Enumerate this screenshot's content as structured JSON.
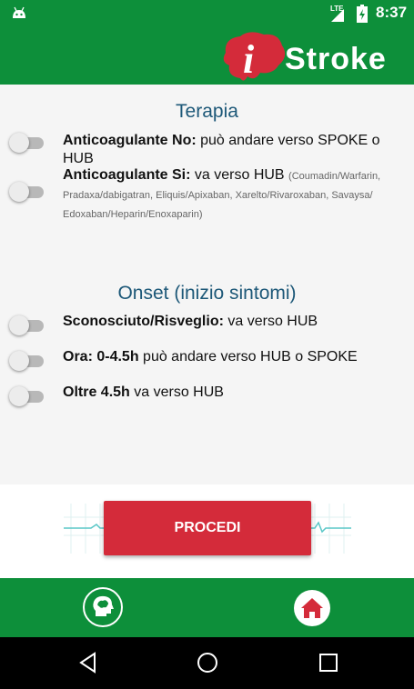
{
  "status_bar": {
    "network": "LTE",
    "time": "8:37"
  },
  "app_bar": {
    "logo_letter": "i",
    "logo_text": "Stroke"
  },
  "terapia": {
    "title": "Terapia",
    "options": [
      {
        "bold": "Anticoagulante No:",
        "text": " può andare verso SPOKE o HUB",
        "detail": ""
      },
      {
        "bold": "Anticoagulante Si:",
        "text": " va verso HUB",
        "detail": "(Coumadin/Warfarin, Pradaxa/dabigatran, Eliquis/Apixaban, Xarelto/Rivaroxaban, Savaysa/ Edoxaban/Heparin/Enoxaparin)"
      }
    ]
  },
  "onset": {
    "title": "Onset (inizio sintomi)",
    "options": [
      {
        "bold": "Sconosciuto/Risveglio:",
        "text": " va verso HUB"
      },
      {
        "bold": "Ora: 0-4.5h",
        "text": " può andare verso HUB o SPOKE"
      },
      {
        "bold": "Oltre 4.5h",
        "text": " va verso HUB"
      }
    ]
  },
  "procedi_label": "PROCEDI",
  "bottom_nav": {
    "left_icon": "brain-head-icon",
    "right_icon": "home-icon"
  },
  "system_nav": {
    "back": "back-icon",
    "home": "home-circle-icon",
    "recents": "recents-icon"
  },
  "colors": {
    "primary": "#0d8f3a",
    "accent": "#d42b3a",
    "title": "#1d5878"
  }
}
